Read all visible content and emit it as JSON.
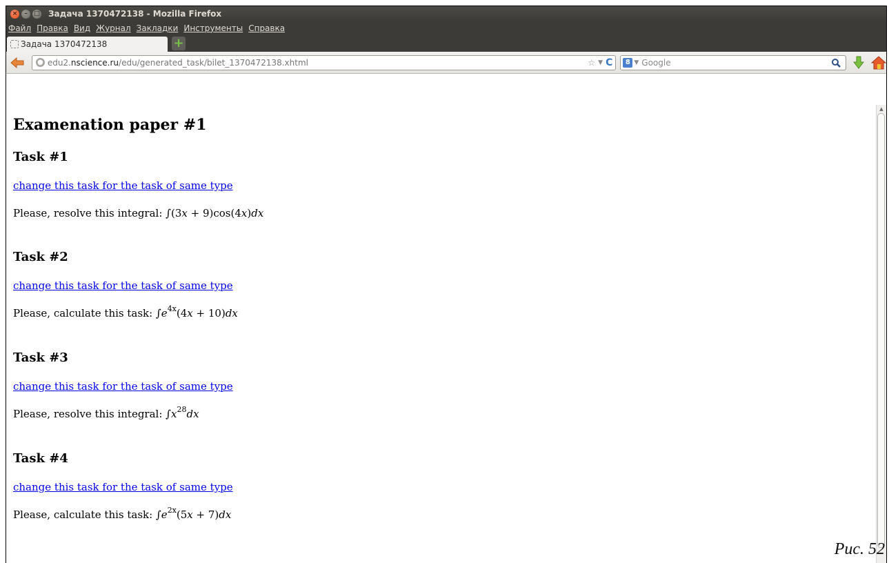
{
  "window": {
    "title": "Задача 1370472138 - Mozilla Firefox"
  },
  "menu": [
    "Файл",
    "Правка",
    "Вид",
    "Журнал",
    "Закладки",
    "Инструменты",
    "Справка"
  ],
  "tab": {
    "label": "Задача 1370472138"
  },
  "urlbar": {
    "prefix": "edu2.",
    "domain": "nscience.ru",
    "path": "/edu/generated_task/bilet_1370472138.xhtml"
  },
  "search": {
    "engine": "Google"
  },
  "page": {
    "title": "Examenation paper #1",
    "tasks": [
      {
        "heading": "Task #1",
        "link": "change this task for the task of same type",
        "prompt": "Please, resolve this integral: ",
        "math_pre": "∫(3",
        "math_mid": " + 9)cos(4",
        "math_post": ")",
        "math_tail": "x"
      },
      {
        "heading": "Task #2",
        "link": "change this task for the task of same type",
        "prompt": "Please, calculate this task: ",
        "exp": "4x",
        "math_post": "(4",
        "math_tail": " + 10)"
      },
      {
        "heading": "Task #3",
        "link": "change this task for the task of same type",
        "prompt": "Please, resolve this integral: ",
        "exp": "28"
      },
      {
        "heading": "Task #4",
        "link": "change this task for the task of same type",
        "prompt": "Please, calculate this task: ",
        "exp": "2x",
        "math_post": "(5",
        "math_tail": " + 7)"
      }
    ]
  },
  "caption": "Рис. 52"
}
